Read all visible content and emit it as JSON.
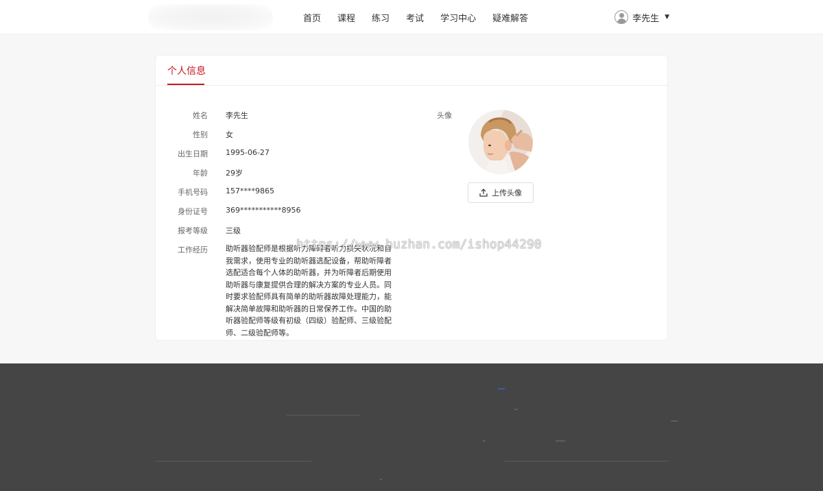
{
  "header": {
    "nav": [
      "首页",
      "课程",
      "练习",
      "考试",
      "学习中心",
      "疑难解答"
    ],
    "user_name": "李先生",
    "caret": "▼"
  },
  "card": {
    "title": "个人信息"
  },
  "profile": {
    "rows": [
      {
        "label": "姓名",
        "value": "李先生"
      },
      {
        "label": "性别",
        "value": "女"
      },
      {
        "label": "出生日期",
        "value": "1995-06-27"
      },
      {
        "label": "年龄",
        "value": "29岁"
      },
      {
        "label": "手机号码",
        "value": "157****9865"
      },
      {
        "label": "身份证号",
        "value": "369***********8956"
      },
      {
        "label": "报考等级",
        "value": "三级"
      },
      {
        "label": "工作经历",
        "value": "助听器验配师是根据听力障碍者听力损失状况和自我需求，使用专业的助听器选配设备，帮助听障者选配适合每个人体的助听器，并为听障者后期使用助听器与康复提供合理的解决方案的专业人员。同时要求验配师具有简单的助听器故障处理能力，能解决简单故障和助听器的日常保养工作。中国的助听器验配师等级有初级（四级）验配师、三级验配师、二级验配师等。"
      }
    ],
    "avatar_label": "头像",
    "upload_label": "上传头像"
  },
  "watermark": "https://www.huzhan.com/ishop44290",
  "icons": {
    "user": "user-circle-icon",
    "upload": "upload-icon"
  },
  "colors": {
    "accent": "#c8161e",
    "footer_bg": "#454545",
    "page_bg": "#f7f7f7"
  }
}
